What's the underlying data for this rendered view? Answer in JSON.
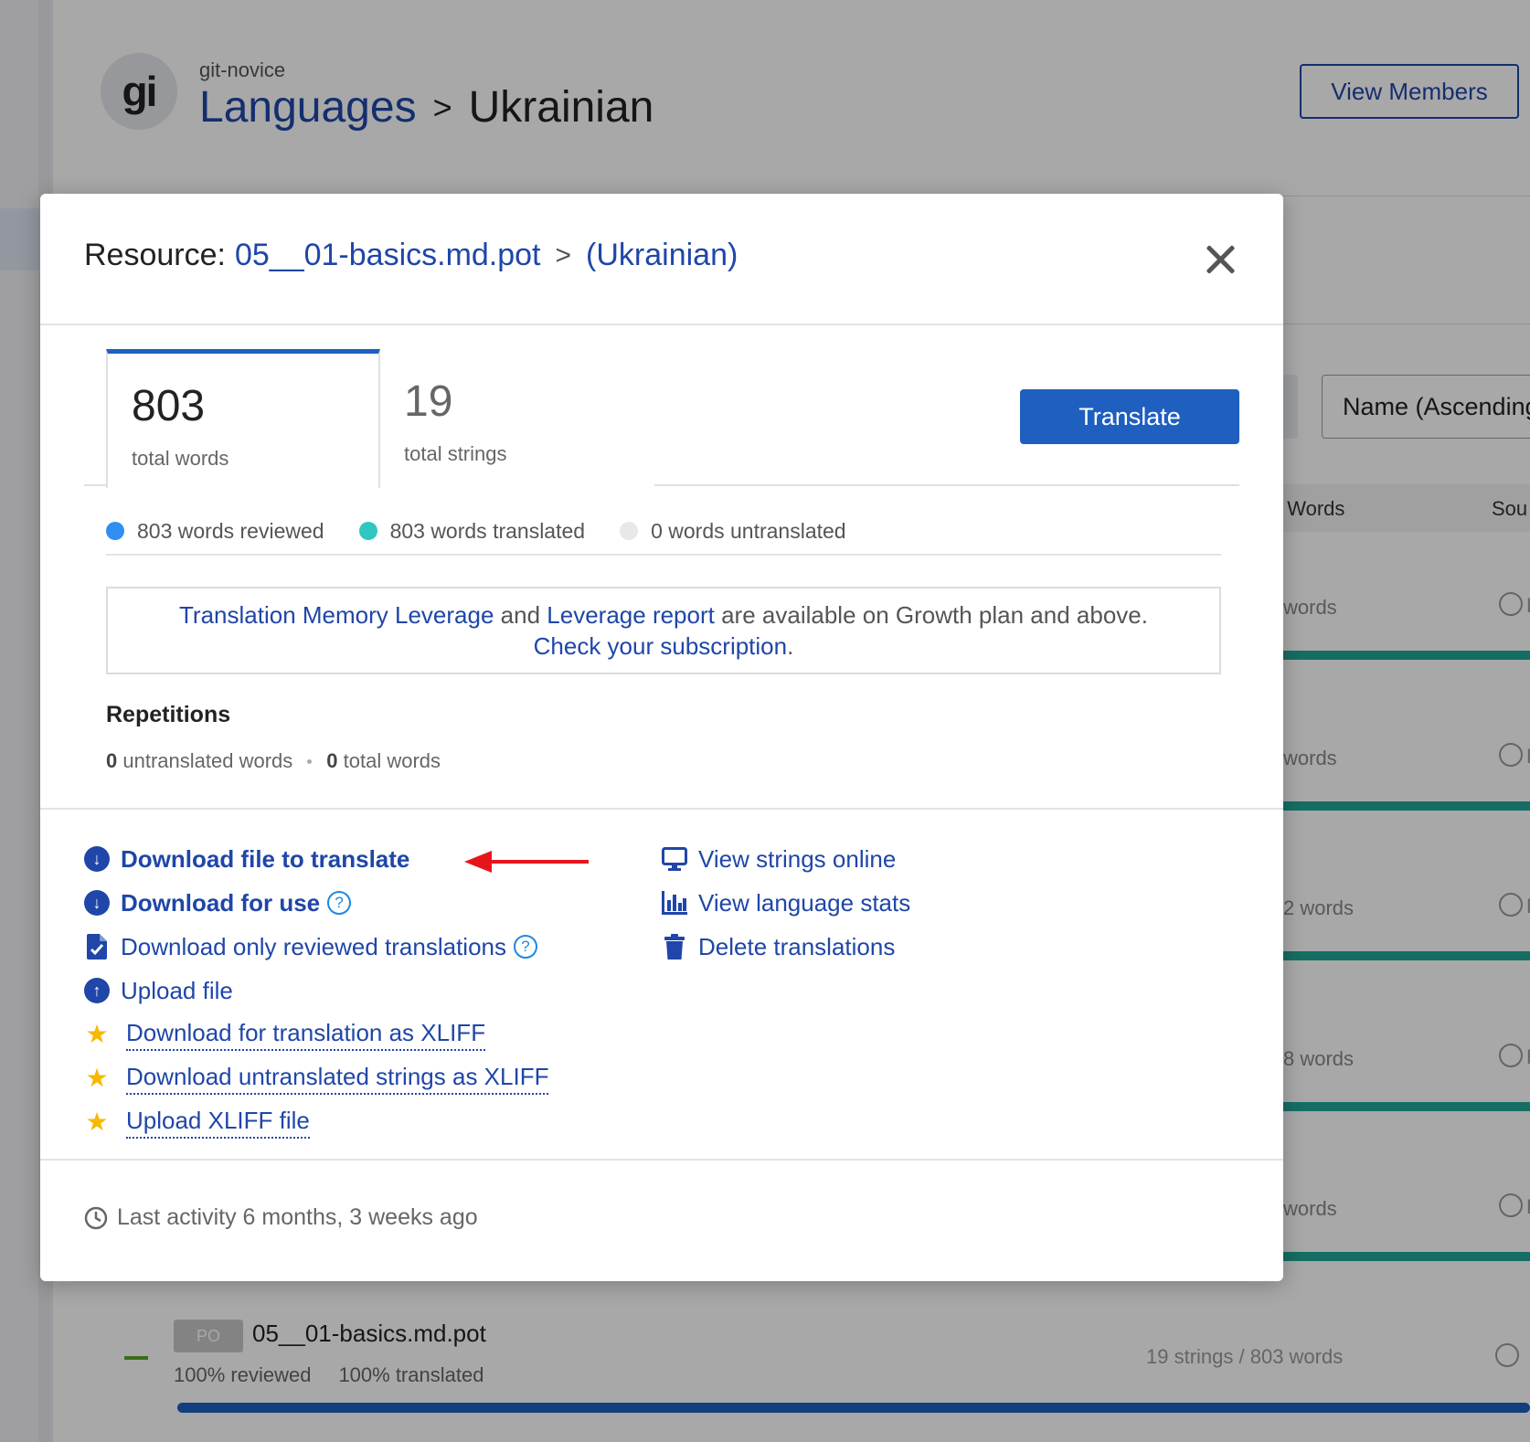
{
  "background": {
    "avatar_text": "gi",
    "project_name": "git-novice",
    "breadcrumb": {
      "root": "Languages",
      "separator": ">",
      "current": "Ukrainian"
    },
    "view_members_label": "View Members",
    "sort_label": "Name (Ascending",
    "table_header": {
      "words": "/ Words",
      "source": "Sou"
    },
    "rows": [
      {
        "words": "words",
        "f": "F"
      },
      {
        "words": "words",
        "f": "F"
      },
      {
        "words": "2 words",
        "f": "F"
      },
      {
        "words": "8 words",
        "f": "F"
      },
      {
        "words": "words",
        "f": "F"
      }
    ],
    "file_row": {
      "code": "PO",
      "name": "05__01-basics.md.pot",
      "reviewed": "100% reviewed",
      "translated": "100% translated",
      "stats": "19 strings / 803 words",
      "f": "F"
    }
  },
  "modal": {
    "title_prefix": "Resource:",
    "resource_name": "05__01-basics.md.pot",
    "separator": ">",
    "language": "(Ukrainian)",
    "tabs": [
      {
        "value": "803",
        "label": "total words"
      },
      {
        "value": "19",
        "label": "total strings"
      }
    ],
    "translate_label": "Translate",
    "legend": [
      {
        "label": "803 words reviewed",
        "color": "#2f8ff0"
      },
      {
        "label": "803 words translated",
        "color": "#2ec8c0"
      },
      {
        "label": "0 words untranslated",
        "color": "#e8e8ea"
      }
    ],
    "notice": {
      "link1": "Translation Memory Leverage",
      "and": "and",
      "link2": "Leverage report",
      "rest": "are available on Growth plan and above.",
      "link3": "Check your subscription",
      "period": "."
    },
    "repetitions": {
      "title": "Repetitions",
      "untranslated_count": "0",
      "untranslated_label": "untranslated words",
      "total_count": "0",
      "total_label": "total words"
    },
    "actions_left": [
      {
        "label": "Download file to translate",
        "icon": "download-circle-icon"
      },
      {
        "label": "Download for use",
        "icon": "download-circle-icon"
      },
      {
        "label": "Download only reviewed translations",
        "icon": "file-check-icon"
      },
      {
        "label": "Upload file",
        "icon": "upload-circle-icon"
      },
      {
        "label": "Download for translation as XLIFF",
        "icon": "star-icon"
      },
      {
        "label": "Download untranslated strings as XLIFF",
        "icon": "star-icon"
      },
      {
        "label": "Upload XLIFF file",
        "icon": "star-icon"
      }
    ],
    "actions_right": [
      {
        "label": "View strings online",
        "icon": "monitor-icon"
      },
      {
        "label": "View language stats",
        "icon": "bar-chart-icon"
      },
      {
        "label": "Delete translations",
        "icon": "trash-icon"
      }
    ],
    "help_glyph": "?",
    "last_activity": "Last activity 6 months, 3 weeks ago"
  },
  "colors": {
    "link": "#1f46a8",
    "primary": "#1e5fc0",
    "teal": "#21a796",
    "star": "#f6b800",
    "arrow": "#e8141c"
  }
}
